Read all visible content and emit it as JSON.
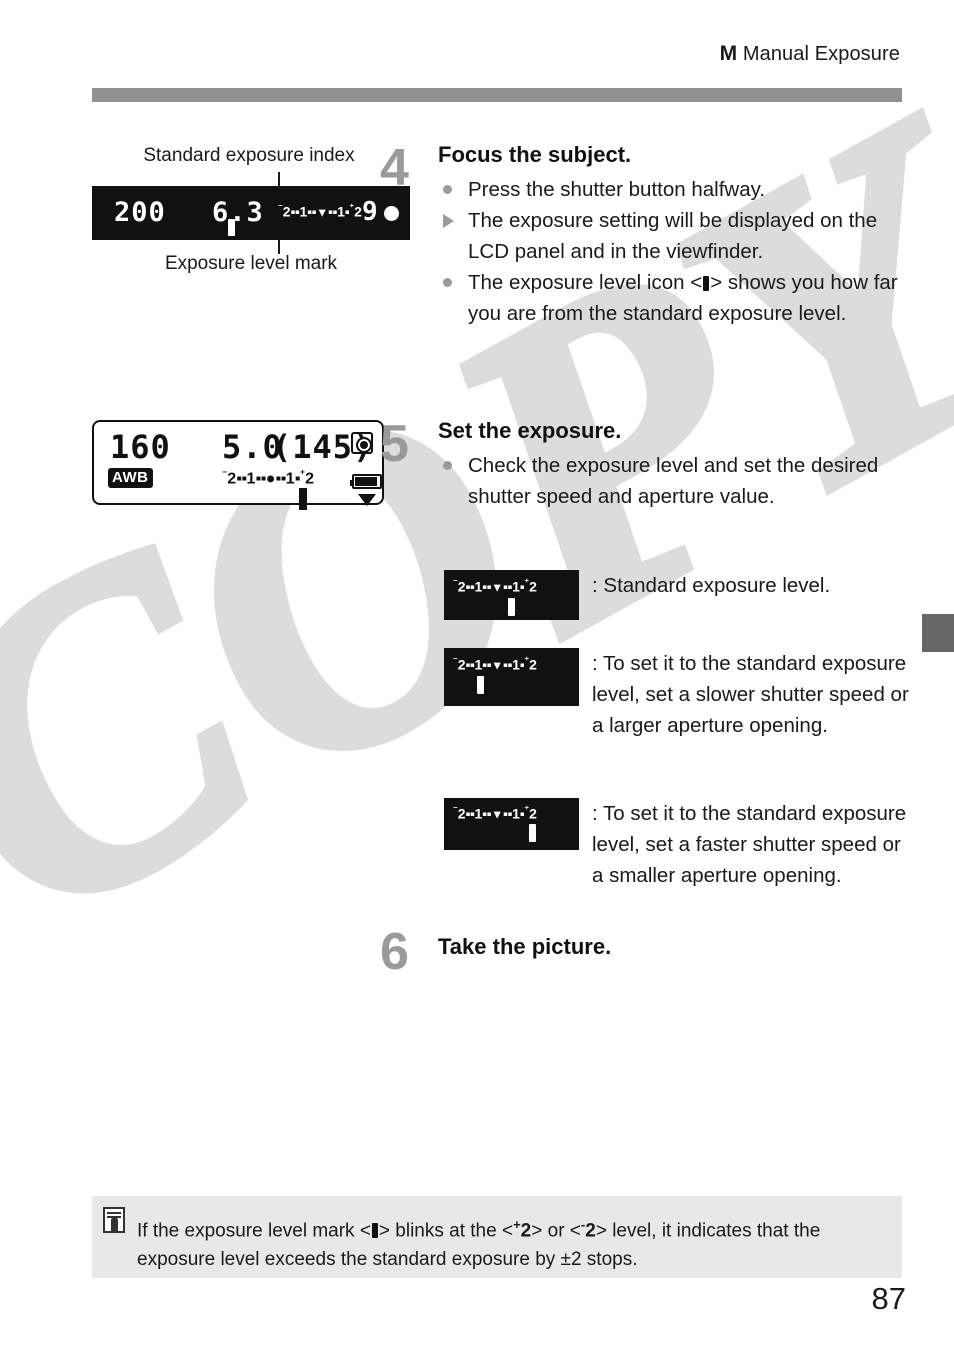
{
  "header": {
    "mode_letter": "M",
    "title": "Manual Exposure"
  },
  "figures": {
    "viewfinder": {
      "caption_top": "Standard exposure index",
      "caption_bottom": "Exposure level mark",
      "shutter_speed": "200",
      "aperture": "6.3",
      "burst_count": "9",
      "scale": {
        "minus_sign": "-",
        "left_num": "2",
        "dots_left": "..",
        "mid_left_num": "1",
        "dots_mid_left": "..",
        "index_marker": "▼",
        "dots_mid_right": "..",
        "mid_right_num": "1",
        "dots_right": ".",
        "plus_sign": "+",
        "right_num": "2"
      },
      "focus_confirmation": "focus-dot"
    },
    "lcd_panel": {
      "shutter_speed": "160",
      "white_balance": "AWB",
      "aperture": "5.0",
      "remaining_shots": "(145)",
      "metering_icon": "evaluative-metering-icon",
      "battery_icon": "battery-full-icon",
      "scale_label": "-2..1..●..1..+2"
    }
  },
  "steps": [
    {
      "number": "4",
      "title": "Focus the subject.",
      "bullets": [
        {
          "marker": "dot",
          "text": "Press the shutter button halfway."
        },
        {
          "marker": "triangle",
          "text": "The exposure setting will be displayed on the LCD panel and in the viewfinder."
        },
        {
          "marker": "dot",
          "text_before": "The exposure level icon <",
          "icon": "exposure-level-mark-icon",
          "text_after": "> shows you how far you are from the standard exposure level."
        }
      ]
    },
    {
      "number": "5",
      "title": "Set the exposure.",
      "bullets": [
        {
          "marker": "dot",
          "text": "Check the exposure level and set the desired shutter speed and aperture value."
        }
      ]
    },
    {
      "number": "6",
      "title": "Take the picture.",
      "bullets": []
    }
  ],
  "examples": [
    {
      "mark_position": "center",
      "mark_offset_percent": 50,
      "text": ": Standard exposure level.",
      "scale_label": "-2..1..▼..1..+2"
    },
    {
      "mark_position": "left",
      "mark_offset_percent": 27,
      "text": ": To set it to the standard exposure level, set a slower shutter speed or a larger aperture opening.",
      "scale_label": "-2..1..▼..1..+2"
    },
    {
      "mark_position": "right",
      "mark_offset_percent": 63,
      "text": ": To set it to the standard exposure level, set a faster shutter speed or a smaller aperture opening.",
      "scale_label": "-2..1..▼..1..+2"
    }
  ],
  "note": {
    "icon": "note-pencil-icon",
    "text_part1": "If the exposure level mark <",
    "icon_inline": "exposure-level-mark-icon",
    "text_part2": "> blinks at the <",
    "plus_level": "2",
    "plus_sign": "+",
    "text_part3": "> or <",
    "minus_sign": "-",
    "minus_level": "2",
    "text_part4": "> level, it indicates that the exposure level exceeds the standard exposure by ±2 stops.",
    "full_text": "If the exposure level mark < > blinks at the <+2> or <-2> level, it indicates that the exposure level exceeds the standard exposure by ±2 stops."
  },
  "page_number": "87",
  "watermark": {
    "text": "COPY",
    "color": "#dcdcdc"
  },
  "colors": {
    "header_bar": "#919191",
    "step_number": "#9a9a9a",
    "note_background": "#e8e8e8",
    "edge_tab": "#666666"
  }
}
